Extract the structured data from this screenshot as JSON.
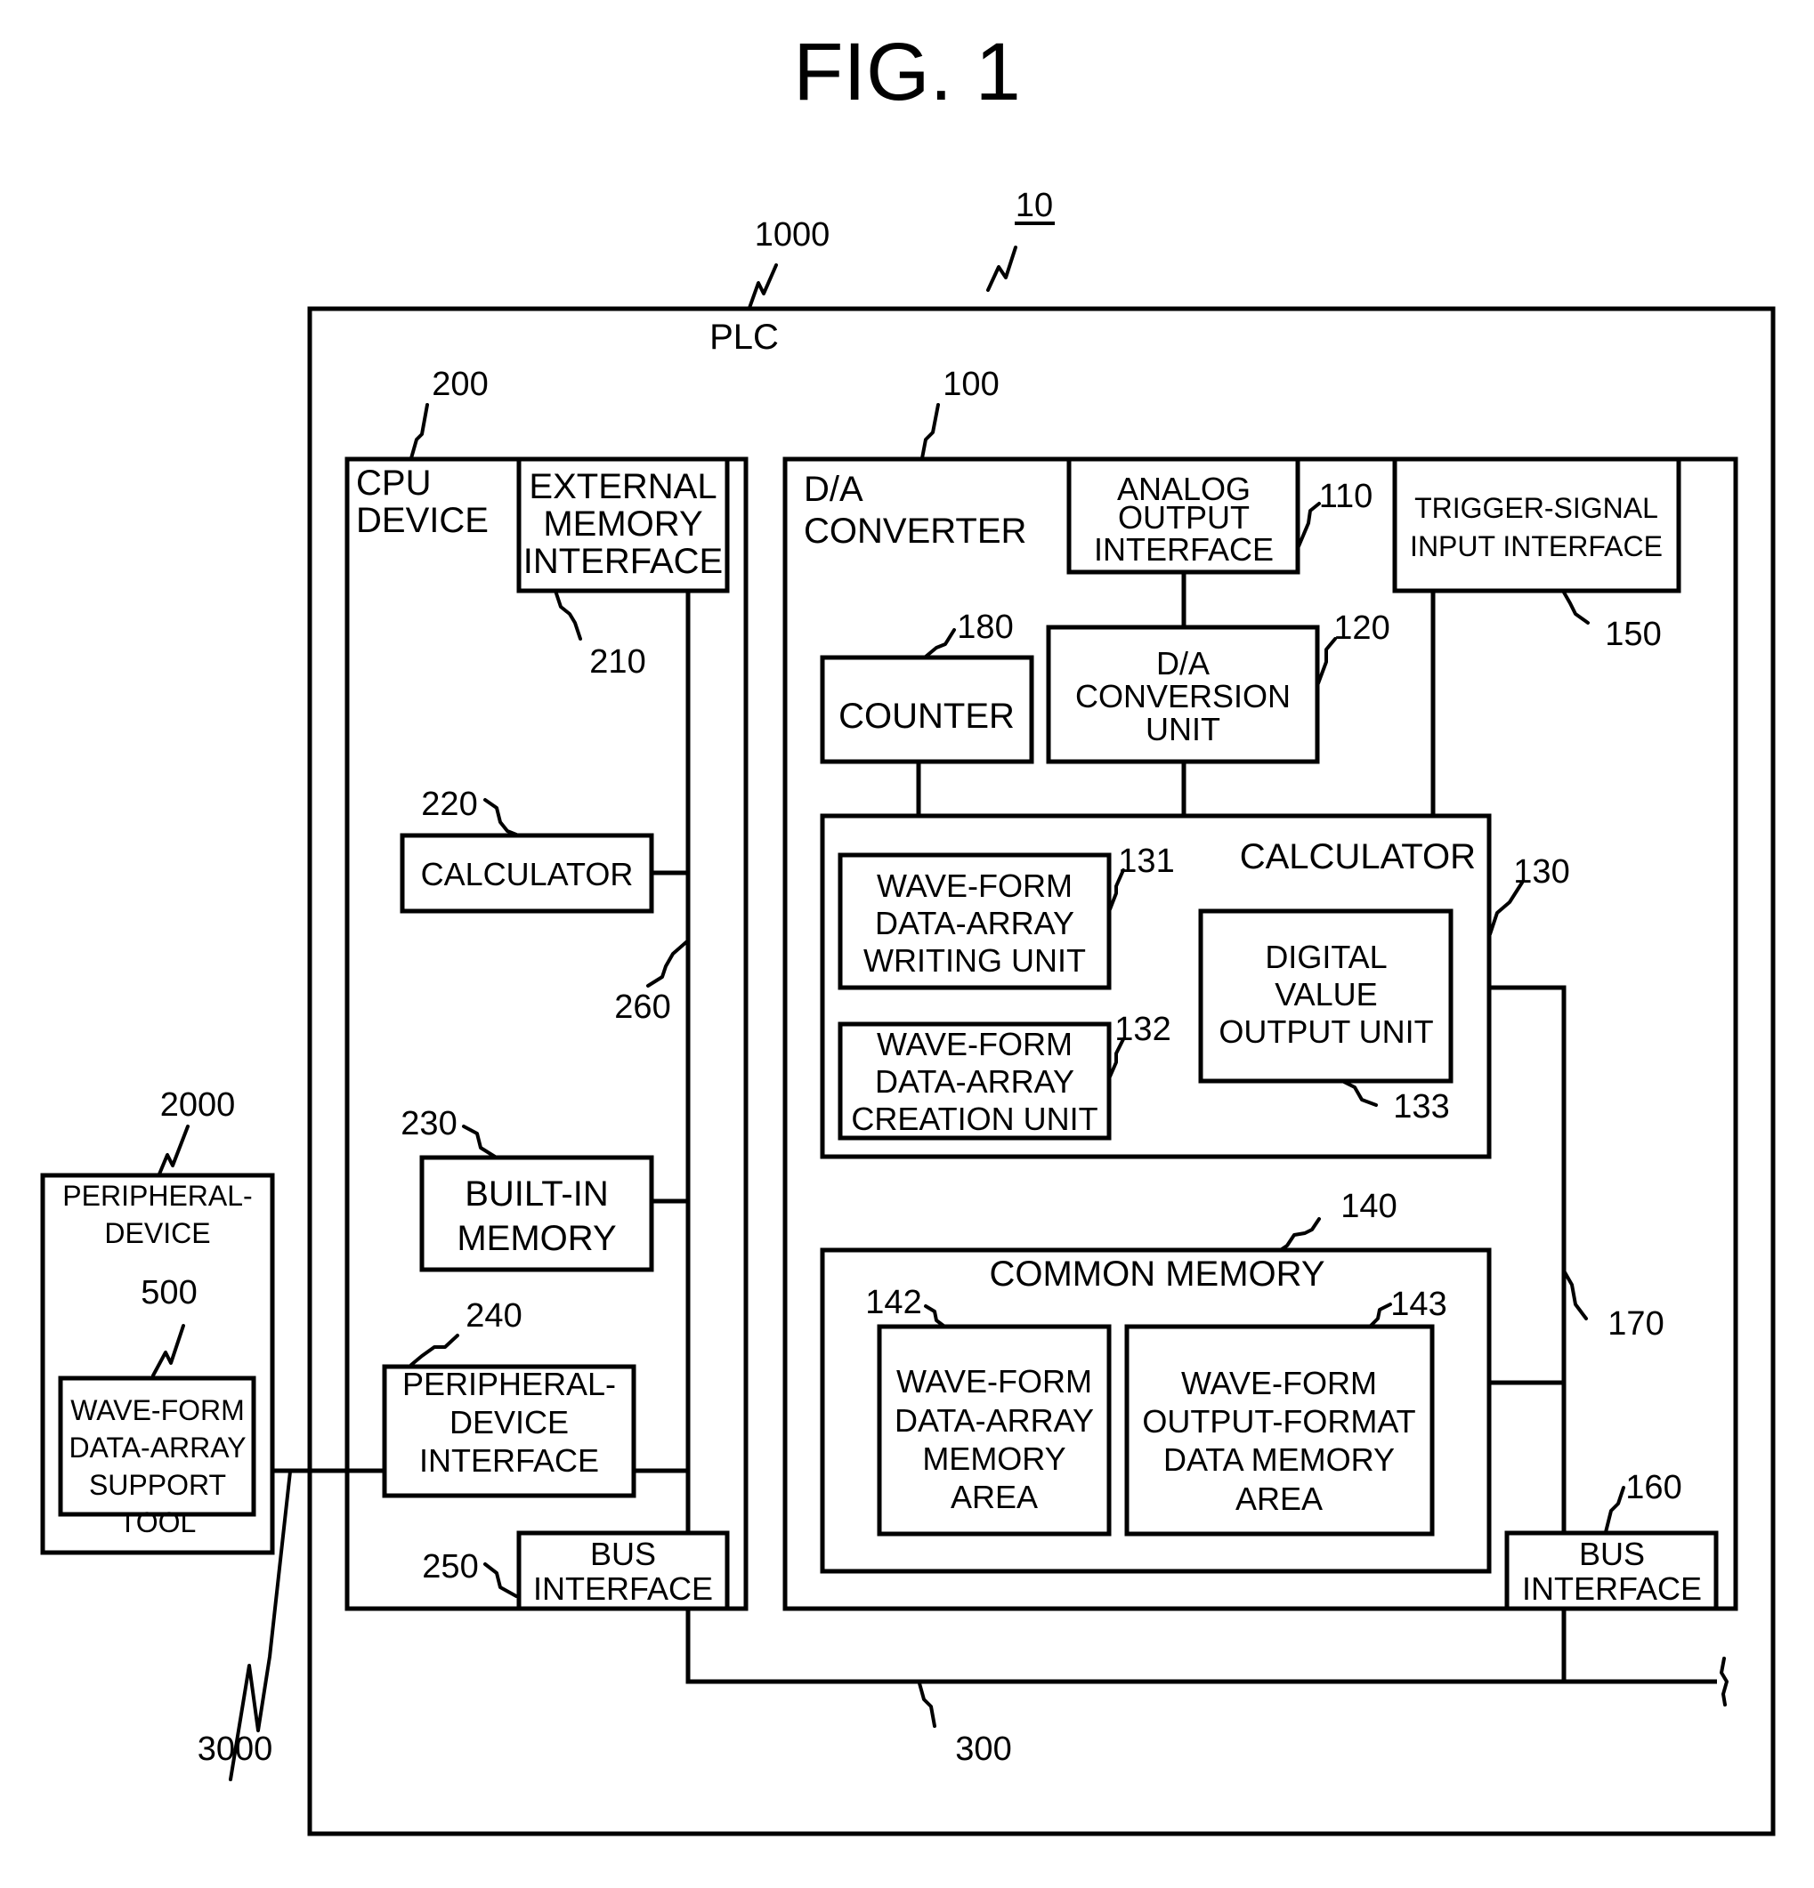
{
  "figure": {
    "title": "FIG. 1",
    "system_ref": "10"
  },
  "plc": {
    "ref": "1000",
    "label": "PLC"
  },
  "cpu_device": {
    "ref": "200",
    "label_lines": [
      "CPU",
      "DEVICE"
    ],
    "external_memory_interface": {
      "ref": "210",
      "label_lines": [
        "EXTERNAL",
        "MEMORY",
        "INTERFACE"
      ]
    },
    "calculator": {
      "ref": "220",
      "label_lines": [
        "CALCULATOR"
      ]
    },
    "internal_bus": {
      "ref": "260"
    },
    "built_in_memory": {
      "ref": "230",
      "label_lines": [
        "BUILT-IN",
        "MEMORY"
      ]
    },
    "peripheral_device_interface": {
      "ref": "240",
      "label_lines": [
        "PERIPHERAL-",
        "DEVICE",
        "INTERFACE"
      ]
    },
    "bus_interface": {
      "ref": "250",
      "label_lines": [
        "BUS",
        "INTERFACE"
      ]
    }
  },
  "da_converter": {
    "ref": "100",
    "label_lines": [
      "D/A",
      "CONVERTER"
    ],
    "analog_output_interface": {
      "ref": "110",
      "label_lines": [
        "ANALOG",
        "OUTPUT",
        "INTERFACE"
      ]
    },
    "trigger_signal_input_interface": {
      "ref": "150",
      "label_lines": [
        "TRIGGER-SIGNAL",
        "INPUT INTERFACE"
      ]
    },
    "counter": {
      "ref": "180",
      "label_lines": [
        "COUNTER"
      ]
    },
    "da_conversion_unit": {
      "ref": "120",
      "label_lines": [
        "D/A",
        "CONVERSION",
        "UNIT"
      ]
    },
    "calculator": {
      "ref": "130",
      "label": "CALCULATOR",
      "writing_unit": {
        "ref": "131",
        "label_lines": [
          "WAVE-FORM",
          "DATA-ARRAY",
          "WRITING UNIT"
        ]
      },
      "creation_unit": {
        "ref": "132",
        "label_lines": [
          "WAVE-FORM",
          "DATA-ARRAY",
          "CREATION UNIT"
        ]
      },
      "digital_value_output_unit": {
        "ref": "133",
        "label_lines": [
          "DIGITAL",
          "VALUE",
          "OUTPUT UNIT"
        ]
      }
    },
    "common_memory": {
      "ref": "140",
      "label": "COMMON MEMORY",
      "data_array_memory_area": {
        "ref": "142",
        "label_lines": [
          "WAVE-FORM",
          "DATA-ARRAY",
          "MEMORY",
          "AREA"
        ]
      },
      "output_format_memory_area": {
        "ref": "143",
        "label_lines": [
          "WAVE-FORM",
          "OUTPUT-FORMAT",
          "DATA MEMORY",
          "AREA"
        ]
      }
    },
    "internal_bus": {
      "ref": "170"
    },
    "bus_interface": {
      "ref": "160",
      "label_lines": [
        "BUS",
        "INTERFACE"
      ]
    }
  },
  "system_bus": {
    "ref": "300"
  },
  "peripheral_device": {
    "ref": "2000",
    "label_lines": [
      "PERIPHERAL-",
      "DEVICE"
    ],
    "support_tool": {
      "ref": "500",
      "label_lines": [
        "WAVE-FORM",
        "DATA-ARRAY",
        "SUPPORT",
        "TOOL"
      ]
    }
  },
  "communication_cable": {
    "ref": "3000"
  }
}
